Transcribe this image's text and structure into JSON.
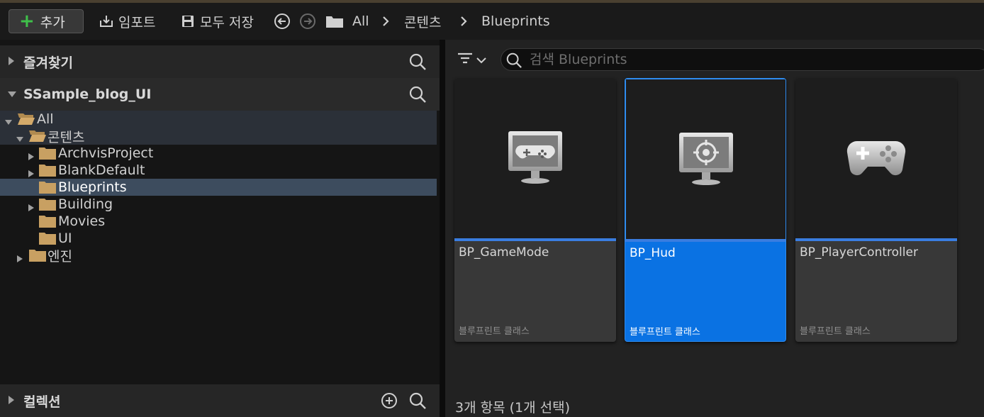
{
  "toolbar": {
    "add_label": "추가",
    "import_label": "임포트",
    "save_all_label": "모두 저장",
    "breadcrumbs": [
      "All",
      "콘텐츠",
      "Blueprints"
    ]
  },
  "left": {
    "favorites_title": "즐겨찾기",
    "project_title": "SSample_blog_UI",
    "collections_title": "컬렉션",
    "tree": [
      {
        "label": "All"
      },
      {
        "label": "콘텐츠"
      },
      {
        "label": "ArchvisProject"
      },
      {
        "label": "BlankDefault"
      },
      {
        "label": "Blueprints"
      },
      {
        "label": "Building"
      },
      {
        "label": "Movies"
      },
      {
        "label": "UI"
      },
      {
        "label": "엔진"
      }
    ]
  },
  "right": {
    "search_placeholder": "검색 Blueprints",
    "assets": [
      {
        "name": "BP_GameMode",
        "type": "블루프린트 클래스",
        "icon": "game-mode-monitor-icon",
        "selected": false
      },
      {
        "name": "BP_Hud",
        "type": "블루프린트 클래스",
        "icon": "hud-monitor-icon",
        "selected": true
      },
      {
        "name": "BP_PlayerController",
        "type": "블루프린트 클래스",
        "icon": "gamepad-icon",
        "selected": false
      }
    ],
    "status": "3개 항목 (1개 선택)"
  },
  "colors": {
    "accent": "#0a72e3",
    "tree_selected": "#3d4c5e",
    "folder": "#c8a062",
    "add_plus": "#3fc04a"
  }
}
